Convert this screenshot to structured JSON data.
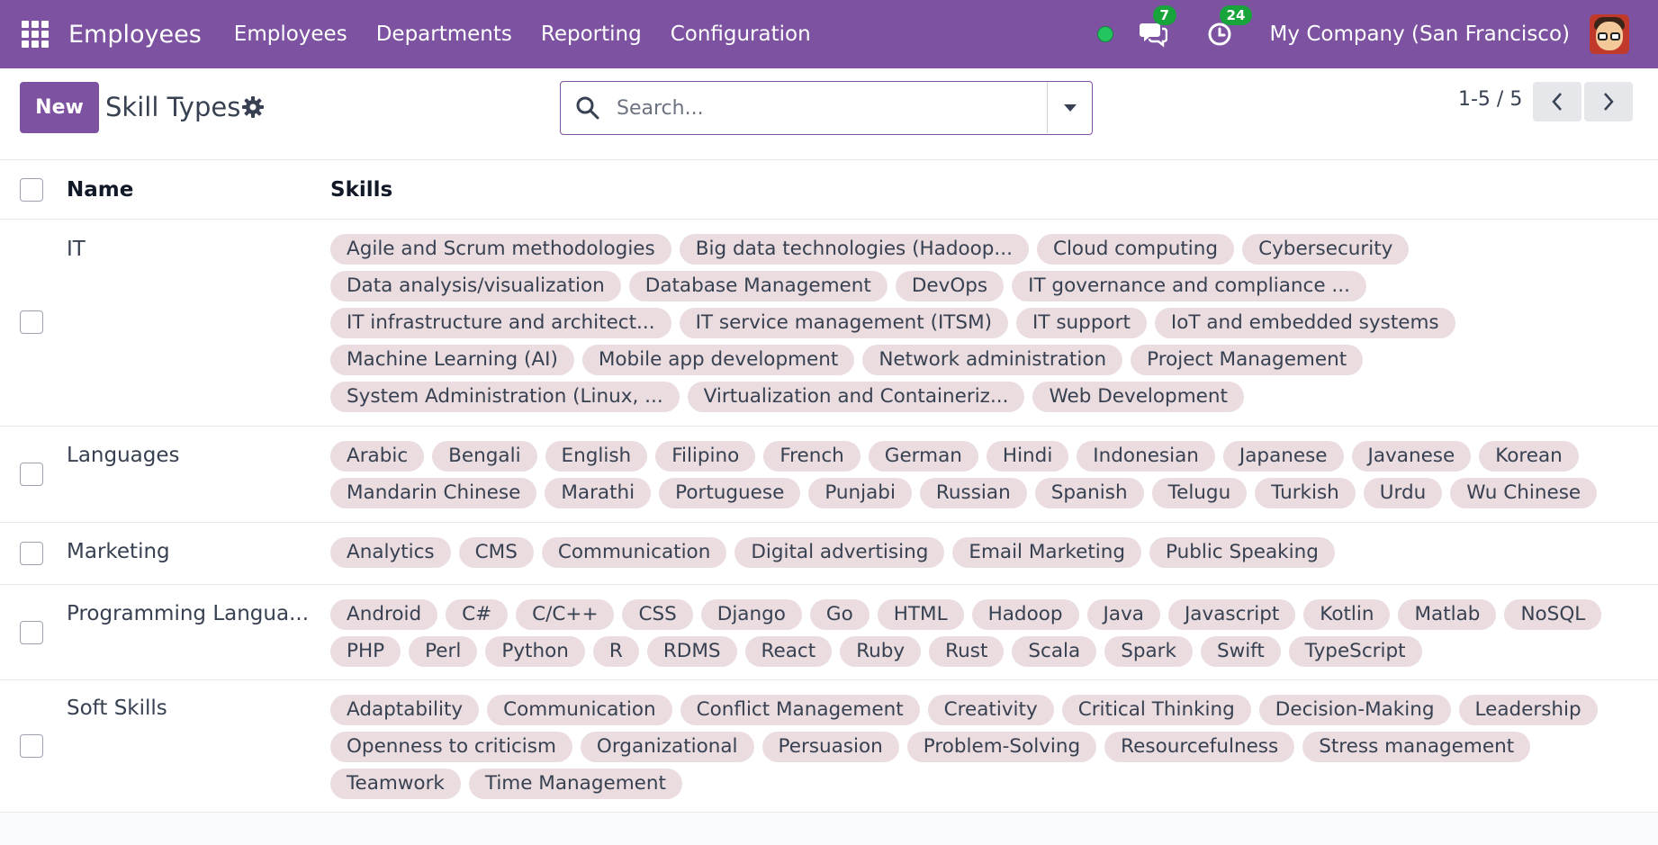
{
  "navbar": {
    "app_title": "Employees",
    "menu": [
      "Employees",
      "Departments",
      "Reporting",
      "Configuration"
    ],
    "messages_count": "7",
    "activities_count": "24",
    "company": "My Company (San Francisco)",
    "accent_color": "#7c52a1"
  },
  "control_panel": {
    "new_label": "New",
    "title": "Skill Types",
    "search_placeholder": "Search...",
    "pager_value": "1-5 / 5"
  },
  "list": {
    "headers": {
      "name": "Name",
      "skills": "Skills"
    },
    "rows": [
      {
        "name": "IT",
        "skills": [
          "Agile and Scrum methodologies",
          "Big data technologies (Hadoop...",
          "Cloud computing",
          "Cybersecurity",
          "Data analysis/visualization",
          "Database Management",
          "DevOps",
          "IT governance and compliance ...",
          "IT infrastructure and architect...",
          "IT service management (ITSM)",
          "IT support",
          "IoT and embedded systems",
          "Machine Learning (AI)",
          "Mobile app development",
          "Network administration",
          "Project Management",
          "System Administration (Linux, ...",
          "Virtualization and Containeriz...",
          "Web Development"
        ]
      },
      {
        "name": "Languages",
        "skills": [
          "Arabic",
          "Bengali",
          "English",
          "Filipino",
          "French",
          "German",
          "Hindi",
          "Indonesian",
          "Japanese",
          "Javanese",
          "Korean",
          "Mandarin Chinese",
          "Marathi",
          "Portuguese",
          "Punjabi",
          "Russian",
          "Spanish",
          "Telugu",
          "Turkish",
          "Urdu",
          "Wu Chinese"
        ]
      },
      {
        "name": "Marketing",
        "skills": [
          "Analytics",
          "CMS",
          "Communication",
          "Digital advertising",
          "Email Marketing",
          "Public Speaking"
        ]
      },
      {
        "name": "Programming Langua...",
        "skills": [
          "Android",
          "C#",
          "C/C++",
          "CSS",
          "Django",
          "Go",
          "HTML",
          "Hadoop",
          "Java",
          "Javascript",
          "Kotlin",
          "Matlab",
          "NoSQL",
          "PHP",
          "Perl",
          "Python",
          "R",
          "RDMS",
          "React",
          "Ruby",
          "Rust",
          "Scala",
          "Spark",
          "Swift",
          "TypeScript"
        ]
      },
      {
        "name": "Soft Skills",
        "skills": [
          "Adaptability",
          "Communication",
          "Conflict Management",
          "Creativity",
          "Critical Thinking",
          "Decision-Making",
          "Leadership",
          "Openness to criticism",
          "Organizational",
          "Persuasion",
          "Problem-Solving",
          "Resourcefulness",
          "Stress management",
          "Teamwork",
          "Time Management"
        ]
      }
    ]
  }
}
